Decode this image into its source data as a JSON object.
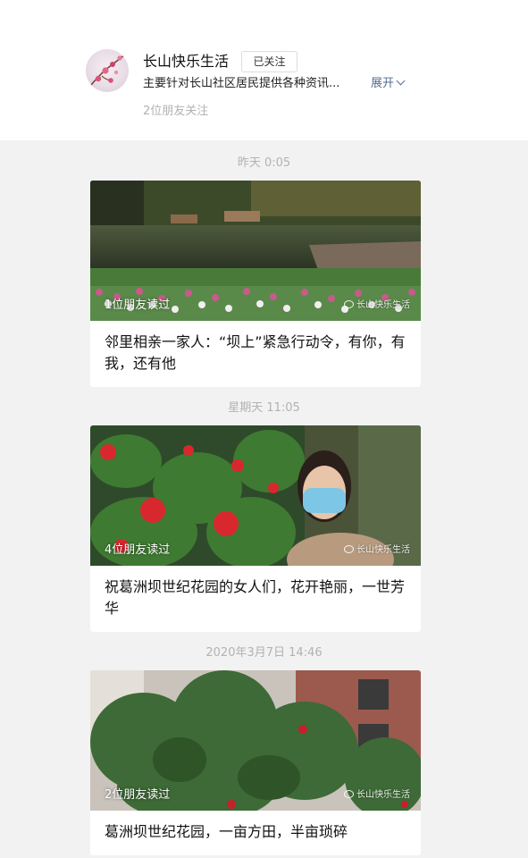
{
  "account": {
    "name": "长山快乐生活",
    "follow_label": "已关注",
    "description": "主要针对长山社区居民提供各种资讯...",
    "expand_label": "展开",
    "friends_following": "2位朋友关注"
  },
  "articles": [
    {
      "time": "昨天 0:05",
      "friends_read": "1位朋友读过",
      "watermark": "长山快乐生活",
      "title": "邻里相亲一家人：“坝上”紧急行动令，有你，有我，还有他"
    },
    {
      "time": "星期天 11:05",
      "friends_read": "4位朋友读过",
      "watermark": "长山快乐生活",
      "title": "祝葛洲坝世纪花园的女人们，花开艳丽，一世芳华"
    },
    {
      "time": "2020年3月7日 14:46",
      "friends_read": "2位朋友读过",
      "watermark": "长山快乐生活",
      "title": "葛洲坝世纪花园，一亩方田，半亩琐碎"
    }
  ]
}
